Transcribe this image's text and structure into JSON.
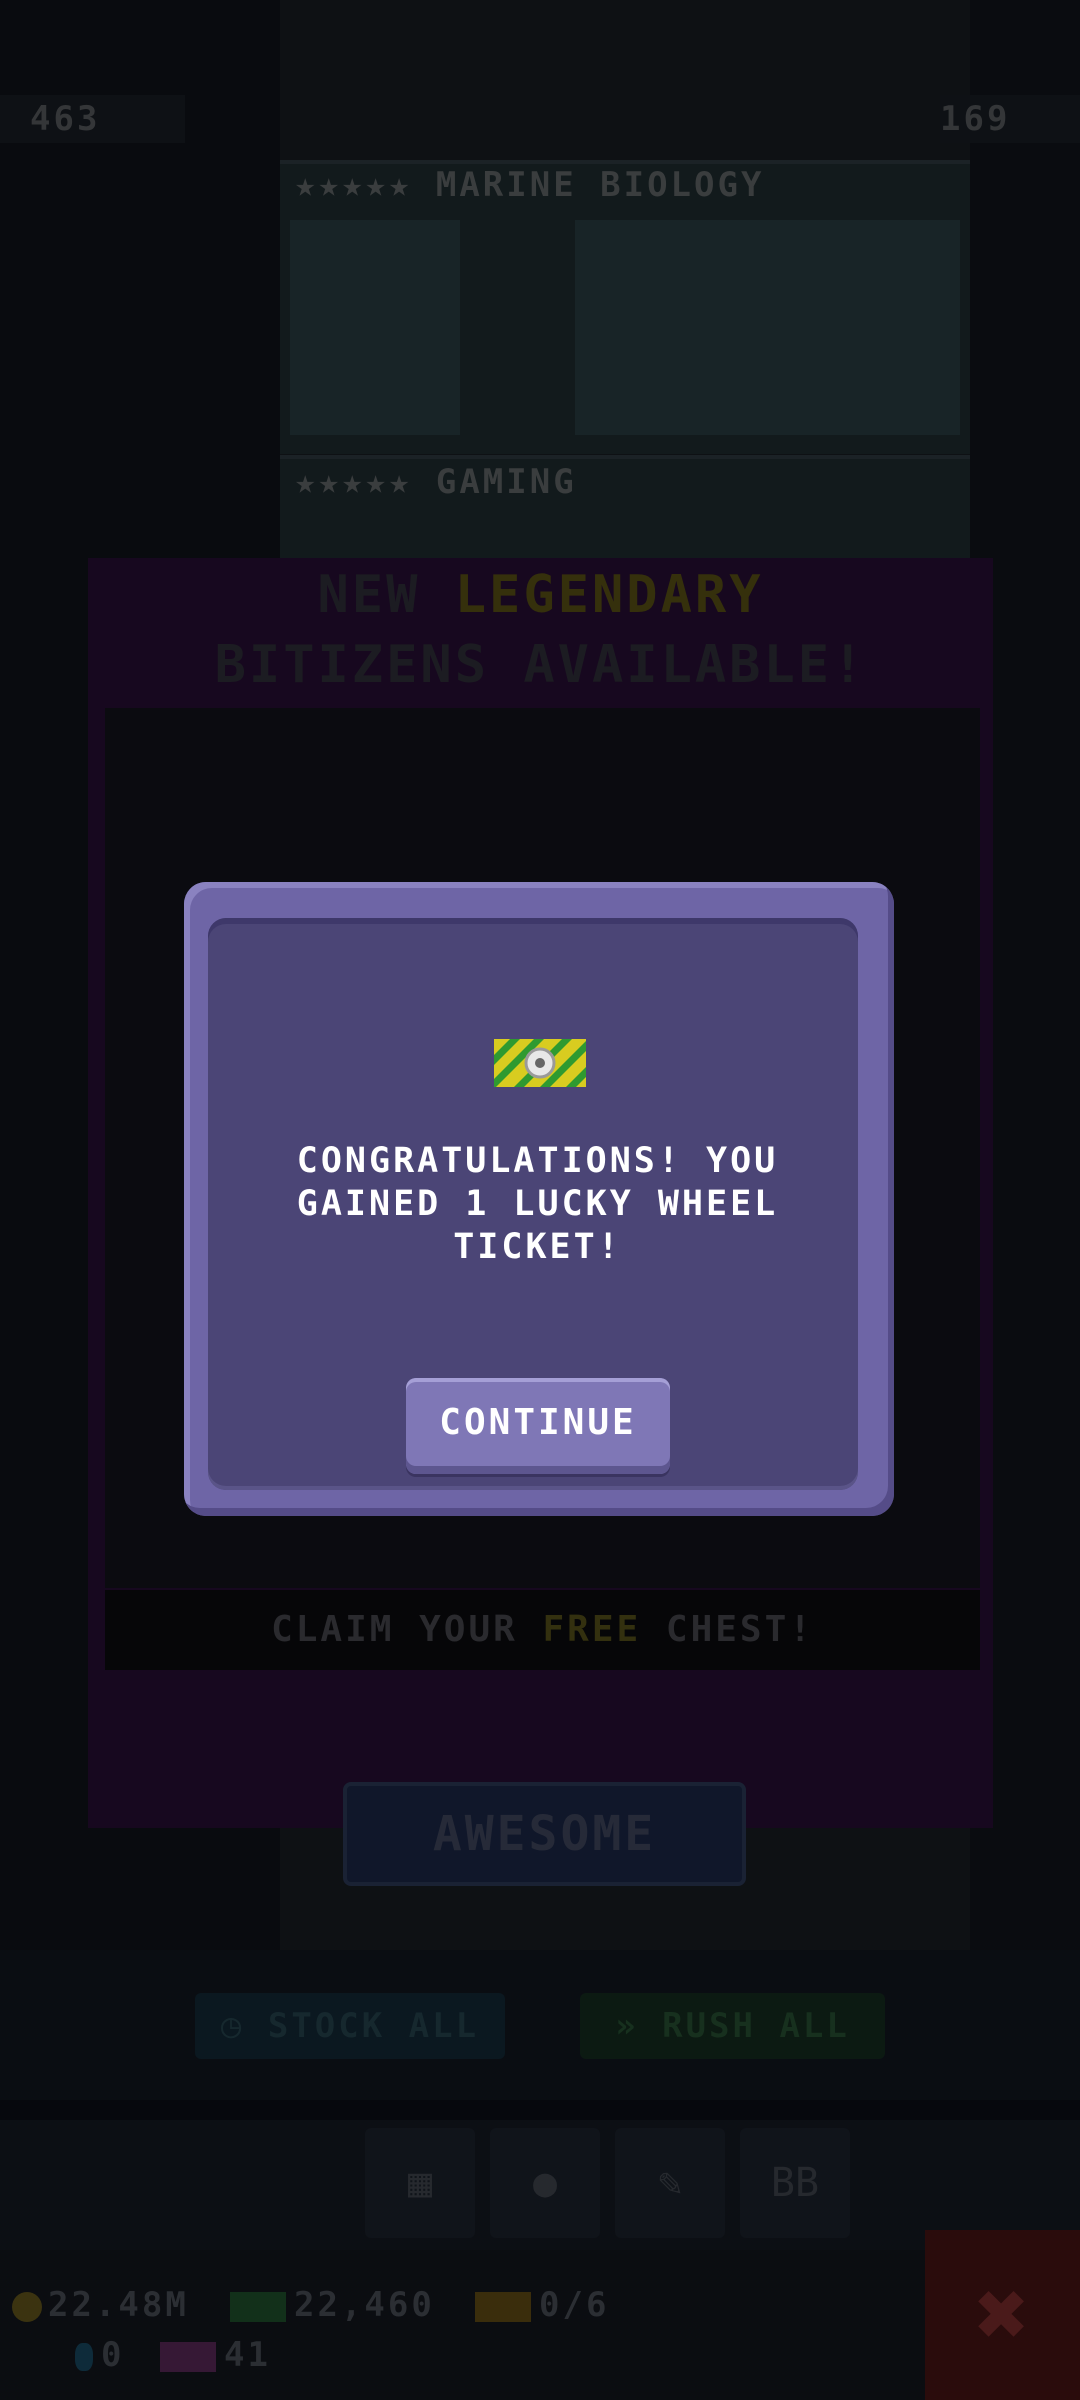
{
  "top_counters": {
    "left": "463",
    "right": "169"
  },
  "floors": [
    {
      "stars": "★★★★★",
      "name": "MARINE BIOLOGY"
    },
    {
      "stars": "★★★★★",
      "name": "GAMING"
    }
  ],
  "legendary_panel": {
    "title_line1_prefix": "NEW",
    "title_line1_highlight": "LEGENDARY",
    "title_line2": "BITIZENS AVAILABLE!",
    "claim_prefix": "CLAIM YOUR",
    "claim_highlight": "FREE",
    "claim_suffix": "CHEST!",
    "button_label": "AWESOME"
  },
  "action_bar": {
    "stock_all": "STOCK ALL",
    "rush_all": "RUSH ALL"
  },
  "status": {
    "coins": "22.48M",
    "bux": "22,460",
    "vip": "0/6",
    "gems": "0",
    "tv": "41"
  },
  "dialog": {
    "icon": "lucky-wheel-ticket-icon",
    "message": "CONGRATULATIONS! YOU GAINED 1 LUCKY WHEEL TICKET!",
    "continue_label": "CONTINUE"
  },
  "colors": {
    "dialog_border": "#6e65a6",
    "dialog_fill": "#4b4576",
    "button": "#7f77b6",
    "ticket_yellow": "#d8cc20",
    "ticket_green": "#2f9a30"
  }
}
